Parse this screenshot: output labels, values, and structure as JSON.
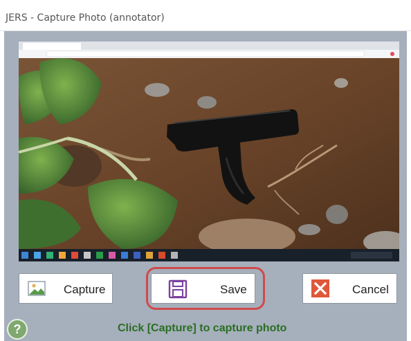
{
  "window": {
    "title": "JERS - Capture Photo (annotator)"
  },
  "buttons": {
    "capture_label": "Capture",
    "save_label": "Save",
    "cancel_label": "Cancel"
  },
  "status": {
    "help_symbol": "?",
    "message": "Click [Capture] to capture photo"
  },
  "icons": {
    "capture": "image-icon",
    "save": "floppy-disk-icon",
    "cancel": "close-icon",
    "help": "help-icon"
  },
  "colors": {
    "client_background": "#a6afbc",
    "status_text": "#2a6e22",
    "cancel_icon": "#e0573a",
    "save_icon": "#7b3fa0",
    "highlight": "#d04a4a"
  }
}
